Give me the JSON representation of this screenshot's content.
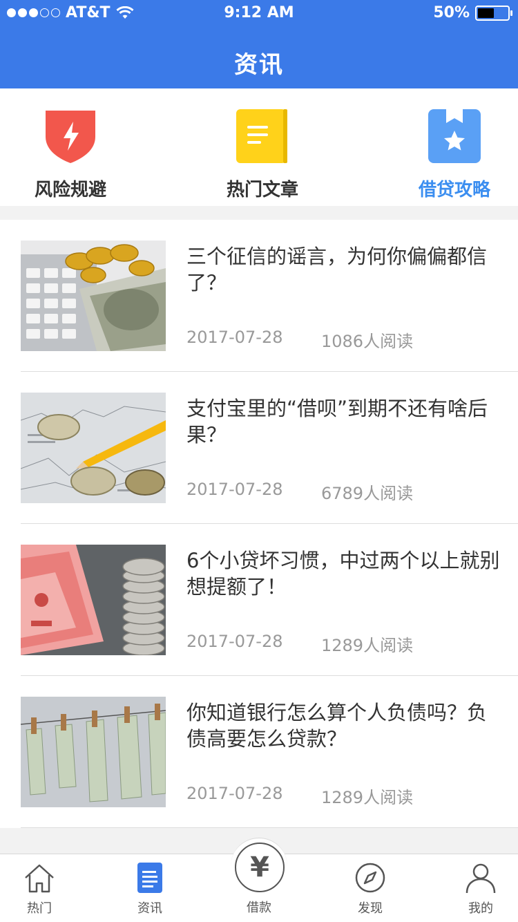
{
  "status": {
    "carrier": "AT&T",
    "time": "9:12 AM",
    "battery": "50%",
    "battery_level": 0.5
  },
  "nav": {
    "title": "资讯"
  },
  "categories": [
    {
      "label": "风险规避",
      "icon": "shield-lightning-icon",
      "color": "#f2574c",
      "active": false
    },
    {
      "label": "热门文章",
      "icon": "notebook-icon",
      "color": "#ffd21a",
      "active": false
    },
    {
      "label": "借贷攻略",
      "icon": "bookmark-star-icon",
      "color": "#5aa0f5",
      "active": true
    }
  ],
  "articles": [
    {
      "title": "三个征信的谣言，为何你偏偏都信了？",
      "date": "2017-07-28",
      "reads": "1086人阅读",
      "image": "calculator-coins-money"
    },
    {
      "title": "支付宝里的“借呗”到期不还有啥后果？",
      "date": "2017-07-28",
      "reads": "6789人阅读",
      "image": "coins-pencil-chart"
    },
    {
      "title": "6个小贷坏习惯，中过两个以上就别想提额了！",
      "date": "2017-07-28",
      "reads": "1289人阅读",
      "image": "rmb-notes-coin-stack"
    },
    {
      "title": "你知道银行怎么算个人负债吗？负债高要怎么贷款？",
      "date": "2017-07-28",
      "reads": "1289人阅读",
      "image": "dollars-clothespins"
    }
  ],
  "tabbar": {
    "items": [
      {
        "label": "热门",
        "icon": "house-icon"
      },
      {
        "label": "资讯",
        "icon": "document-icon",
        "active": true
      },
      {
        "label": "借款",
        "icon": "yuan-icon"
      },
      {
        "label": "发现",
        "icon": "compass-icon"
      },
      {
        "label": "我的",
        "icon": "person-icon"
      }
    ],
    "center_symbol": "¥"
  },
  "colors": {
    "brand": "#3b7ae8",
    "active_tab": "#3b7ae8",
    "active_category": "#3b8ef0"
  }
}
